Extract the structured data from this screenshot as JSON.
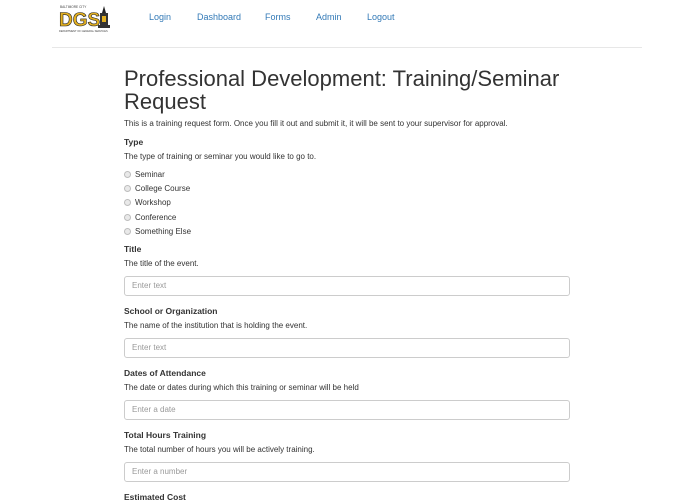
{
  "nav": {
    "logo_text_top": "BALTIMORE CITY",
    "logo_text_main": "DGS",
    "logo_text_bottom": "DEPARTMENT OF GENERAL SERVICES",
    "links": [
      "Login",
      "Dashboard",
      "Forms",
      "Admin",
      "Logout"
    ]
  },
  "page": {
    "title": "Professional Development: Training/Seminar Request",
    "intro": "This is a training request form. Once you fill it out and submit it, it will be sent to your supervisor for approval."
  },
  "type_field": {
    "label": "Type",
    "help": "The type of training or seminar you would like to go to.",
    "options": [
      "Seminar",
      "College Course",
      "Workshop",
      "Conference",
      "Something Else"
    ]
  },
  "title_field": {
    "label": "Title",
    "help": "The title of the event.",
    "placeholder": "Enter text"
  },
  "school_field": {
    "label": "School or Organization",
    "help": "The name of the institution that is holding the event.",
    "placeholder": "Enter text"
  },
  "dates_field": {
    "label": "Dates of Attendance",
    "help": "The date or dates during which this training or seminar will be held",
    "placeholder": "Enter a date"
  },
  "hours_field": {
    "label": "Total Hours Training",
    "help": "The total number of hours you will be actively training.",
    "placeholder": "Enter a number"
  },
  "cost_field": {
    "label": "Estimated Cost"
  }
}
